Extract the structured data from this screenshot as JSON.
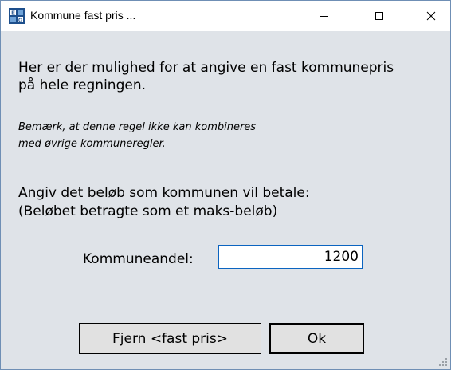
{
  "window": {
    "title": "Kommune fast pris ...",
    "app_icon": "eg-logo-icon",
    "controls": [
      "minimize-icon",
      "maximize-icon",
      "close-icon"
    ]
  },
  "body": {
    "intro_line1": "Her er der mulighed for at angive en fast kommunepris",
    "intro_line2": "på hele regningen.",
    "note_line1": "Bemærk, at denne regel ikke kan kombineres",
    "note_line2": "med øvrige kommuneregler.",
    "instruction_line1": "Angiv det beløb som kommunen vil betale:",
    "instruction_line2": "(Beløbet betragte som et maks-beløb)"
  },
  "form": {
    "label": "Kommuneandel:",
    "value": "1200"
  },
  "buttons": {
    "remove_label": "Fjern <fast pris>",
    "ok_label": "Ok"
  },
  "colors": {
    "window_bg": "#dfe3e8",
    "input_border": "#0b64c0",
    "titlebar_bg": "#ffffff"
  }
}
